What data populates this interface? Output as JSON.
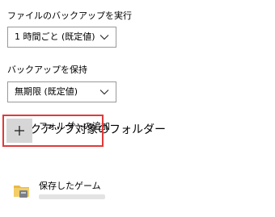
{
  "backup_frequency": {
    "label": "ファイルのバックアップを実行",
    "selected": "1 時間ごと (既定値)"
  },
  "retention": {
    "label": "バックアップを保持",
    "selected": "無期限 (既定値)"
  },
  "folders": {
    "title": "バックアップ対象のフォルダー",
    "add_label": "フォルダーの追加",
    "add_icon": "plus-icon",
    "highlight_color": "#e03a3a",
    "items": [
      {
        "name": "保存したゲーム",
        "icon": "folder-icon"
      }
    ]
  }
}
